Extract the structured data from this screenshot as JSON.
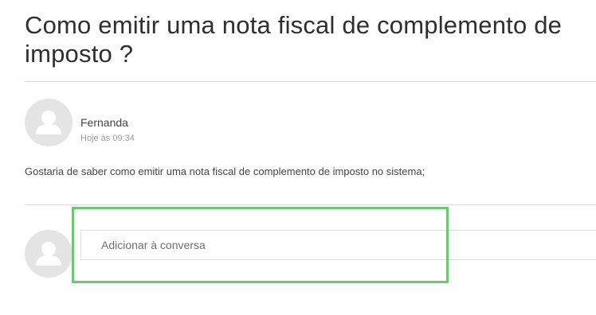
{
  "page": {
    "title": "Como emitir uma nota fiscal de complemento de imposto ?"
  },
  "post": {
    "author": "Fernanda",
    "timestamp": "Hoje às 09:34",
    "message": "Gostaria de saber como emitir uma nota fiscal de complemento de imposto no sistema;"
  },
  "reply": {
    "placeholder": "Adicionar à conversa"
  },
  "icons": {
    "avatar": "user-silhouette-icon"
  },
  "colors": {
    "highlight": "#6cc871",
    "avatar_bg": "#e4e4e4"
  }
}
